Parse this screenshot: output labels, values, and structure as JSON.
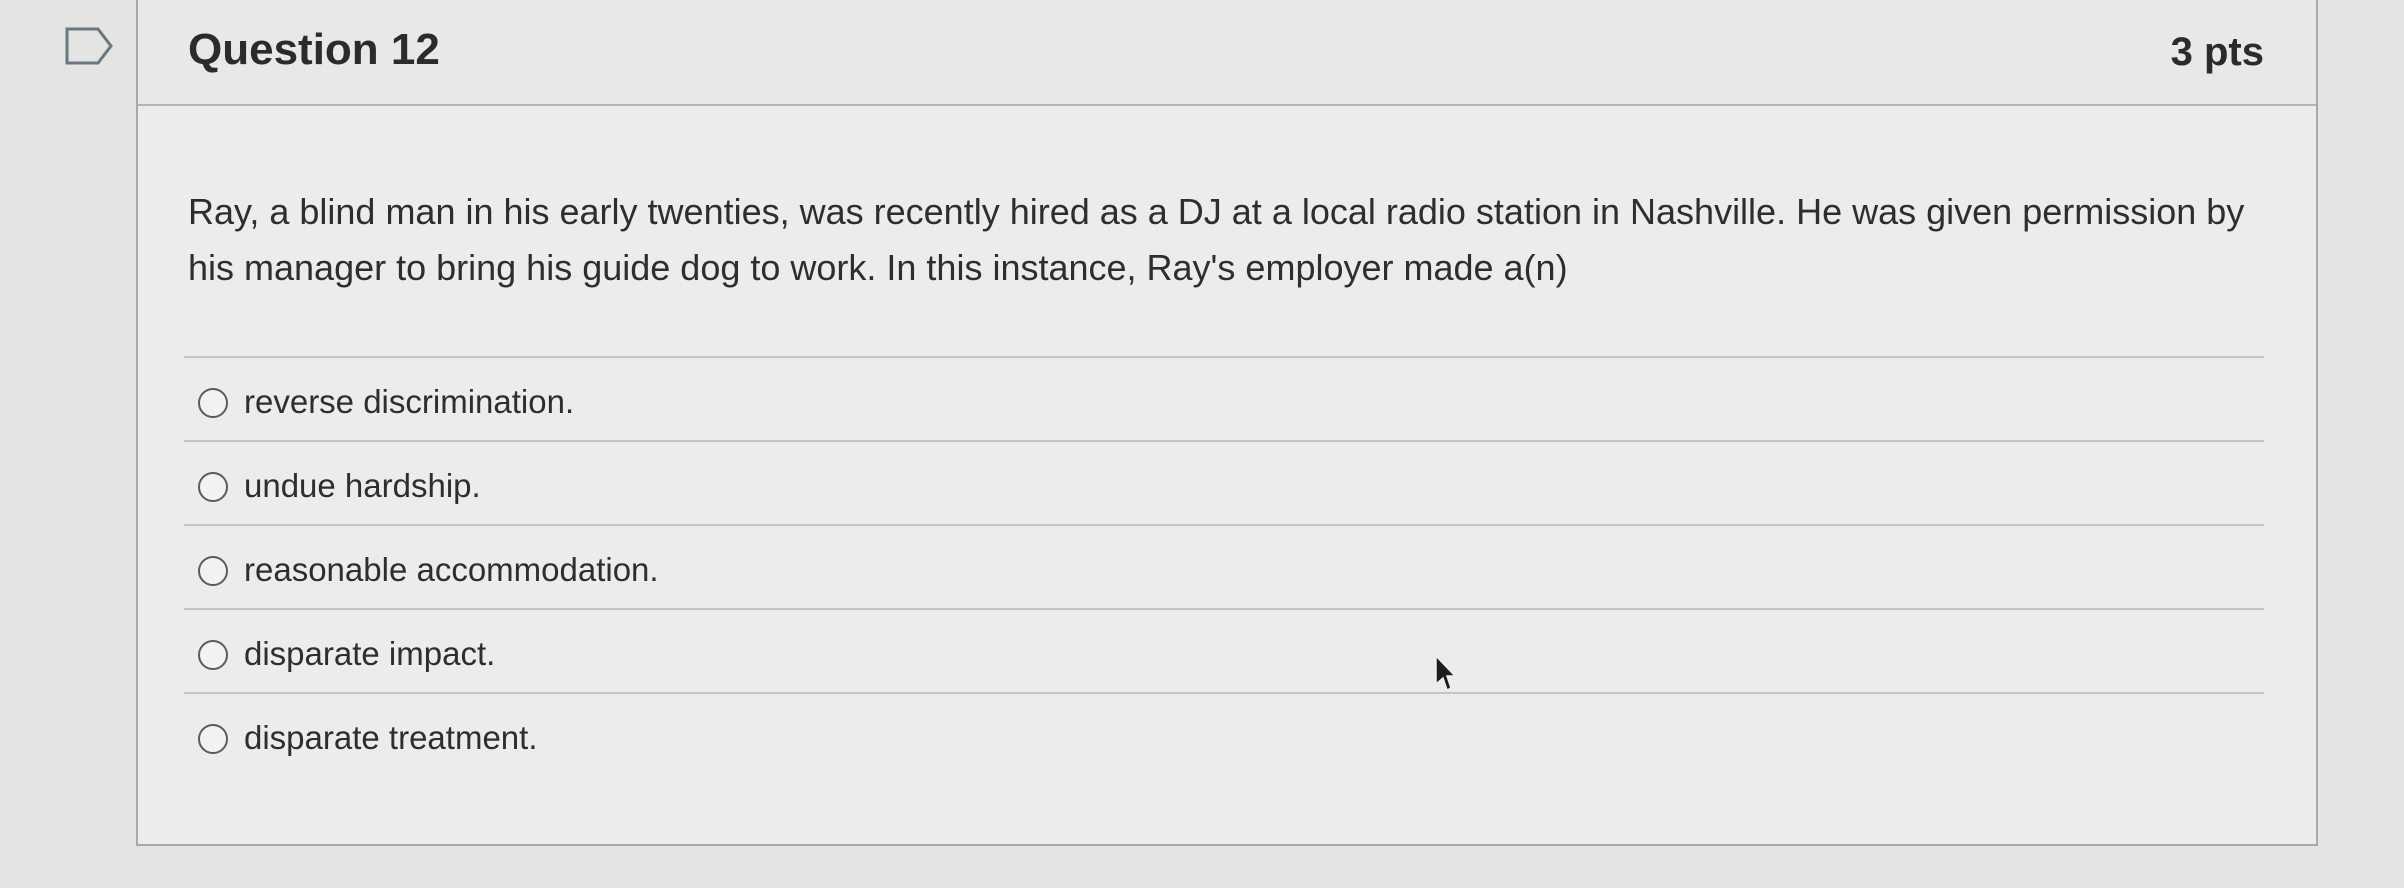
{
  "question": {
    "title": "Question 12",
    "points": "3 pts",
    "text": "Ray, a blind man in his early twenties, was recently hired as a DJ at a local radio station in Nashville. He was given permission by his manager to bring his guide dog to work. In this instance, Ray's employer made a(n)"
  },
  "answers": [
    {
      "label": "reverse discrimination."
    },
    {
      "label": "undue hardship."
    },
    {
      "label": "reasonable accommodation."
    },
    {
      "label": "disparate impact."
    },
    {
      "label": "disparate treatment."
    }
  ],
  "icons": {
    "flag": "flag-question-icon",
    "cursor": "mouse-pointer-icon"
  },
  "colors": {
    "text": "#2d2e30",
    "border": "#a9aaa8",
    "background": "#ececea"
  }
}
